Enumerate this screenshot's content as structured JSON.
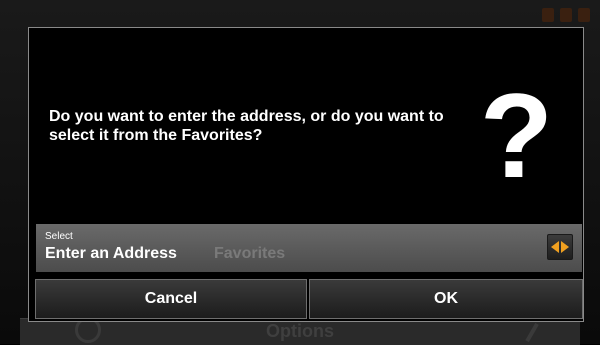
{
  "background": {
    "options_label": "Options"
  },
  "dialog": {
    "prompt": "Do you want to enter the address, or do you want to select it from the Favorites?",
    "question_mark": "?",
    "select": {
      "label": "Select",
      "selected_option": "Enter an Address",
      "other_option": "Favorites",
      "arrow_icon": "left-right-arrow-icon",
      "arrow_color": "#f0a020"
    },
    "buttons": {
      "cancel_label": "Cancel",
      "ok_label": "OK"
    }
  }
}
